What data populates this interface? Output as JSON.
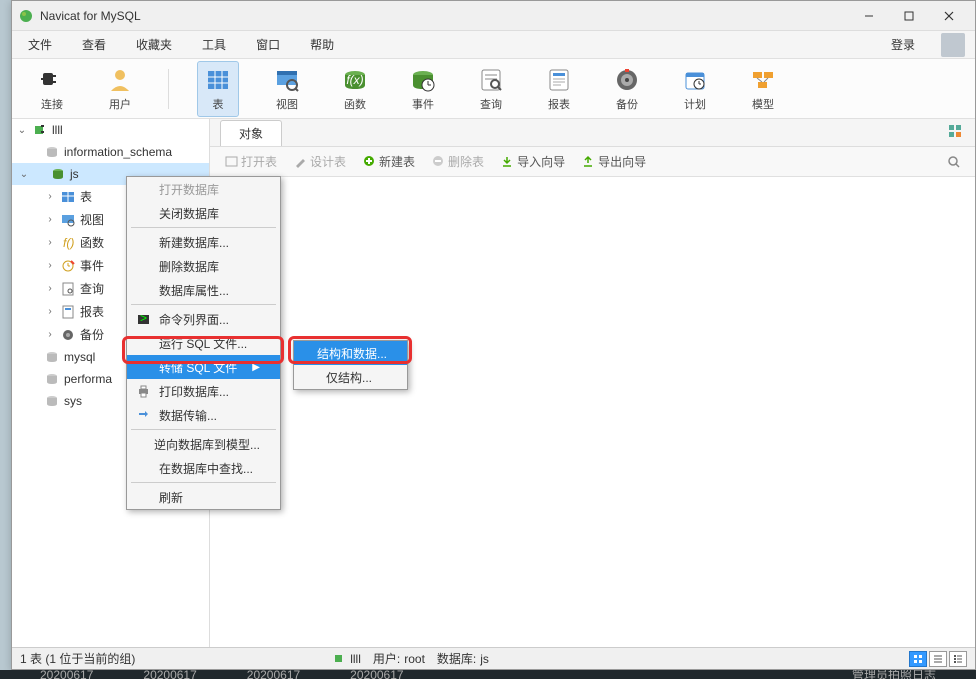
{
  "app": {
    "title": "Navicat for MySQL"
  },
  "menubar": {
    "items": [
      "文件",
      "查看",
      "收藏夹",
      "工具",
      "窗口",
      "帮助"
    ],
    "login": "登录"
  },
  "toolbar": {
    "connect": "连接",
    "user": "用户",
    "table": "表",
    "view": "视图",
    "function": "函数",
    "event": "事件",
    "query": "查询",
    "report": "报表",
    "backup": "备份",
    "schedule": "计划",
    "model": "模型"
  },
  "tree": {
    "connection": "llll",
    "databases": {
      "info_schema": "information_schema",
      "js": "js",
      "mysql": "mysql",
      "performa": "performa",
      "sys": "sys"
    },
    "js_children": {
      "table": "表",
      "view": "视图",
      "function": "函数",
      "event": "事件",
      "query": "查询",
      "report": "报表",
      "backup": "备份"
    }
  },
  "tabs": {
    "objects": "对象"
  },
  "actions": {
    "open_table": "打开表",
    "design_table": "设计表",
    "new_table": "新建表",
    "delete_table": "删除表",
    "import_wizard": "导入向导",
    "export_wizard": "导出向导"
  },
  "context_menu": {
    "open_db": "打开数据库",
    "close_db": "关闭数据库",
    "new_db": "新建数据库...",
    "delete_db": "删除数据库",
    "db_props": "数据库属性...",
    "cmd_interface": "命令列界面...",
    "run_sql": "运行 SQL 文件...",
    "dump_sql": "转储 SQL 文件",
    "print_db": "打印数据库...",
    "data_transfer": "数据传输...",
    "reverse_model": "逆向数据库到模型...",
    "find_in_db": "在数据库中查找...",
    "refresh": "刷新"
  },
  "submenu": {
    "structure_data": "结构和数据...",
    "structure_only": "仅结构..."
  },
  "statusbar": {
    "tables": "1 表 (1 位于当前的组)",
    "connection": "llll",
    "user_label": "用户:",
    "user_value": "root",
    "db_label": "数据库:",
    "db_value": "js"
  },
  "bottom_strip": {
    "dates": [
      "20200617",
      "20200617",
      "20200617",
      "20200617"
    ],
    "right": "管理员拍照日志"
  }
}
